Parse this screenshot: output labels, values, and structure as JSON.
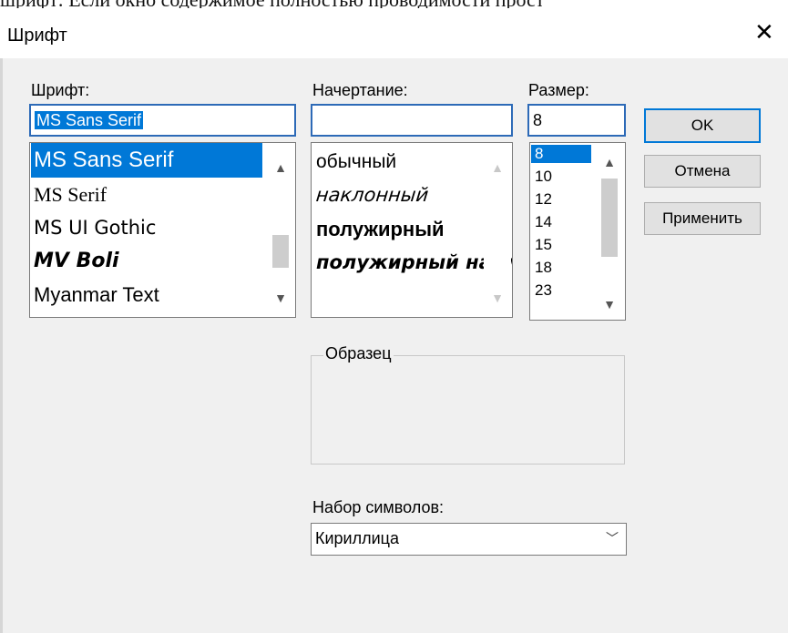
{
  "background_text": "шрифт: Если окно содержимое полностью проводимости прост",
  "dialog": {
    "title": "Шрифт",
    "close_symbol": "✕"
  },
  "font": {
    "label": "Шрифт:",
    "value": "MS Sans Serif",
    "items": [
      "MS Sans Serif",
      "MS Serif",
      "MS UI Gothic",
      "MV Boli",
      "Myanmar Text"
    ],
    "selected_index": 0
  },
  "style": {
    "label": "Начертание:",
    "value": "",
    "items": [
      "обычный",
      "наклонный",
      "полужирный",
      "полужирный наклонный"
    ]
  },
  "size": {
    "label": "Размер:",
    "value": "8",
    "items": [
      "8",
      "10",
      "12",
      "14",
      "15",
      "18",
      "23"
    ],
    "selected_index": 0
  },
  "buttons": {
    "ok": "OK",
    "cancel": "Отмена",
    "apply": "Применить"
  },
  "sample": {
    "label": "Образец"
  },
  "charset": {
    "label": "Набор символов:",
    "value": "Кириллица"
  },
  "icons": {
    "scroll_up": "▲",
    "scroll_down": "▼",
    "combo_chevron": "﹀"
  }
}
